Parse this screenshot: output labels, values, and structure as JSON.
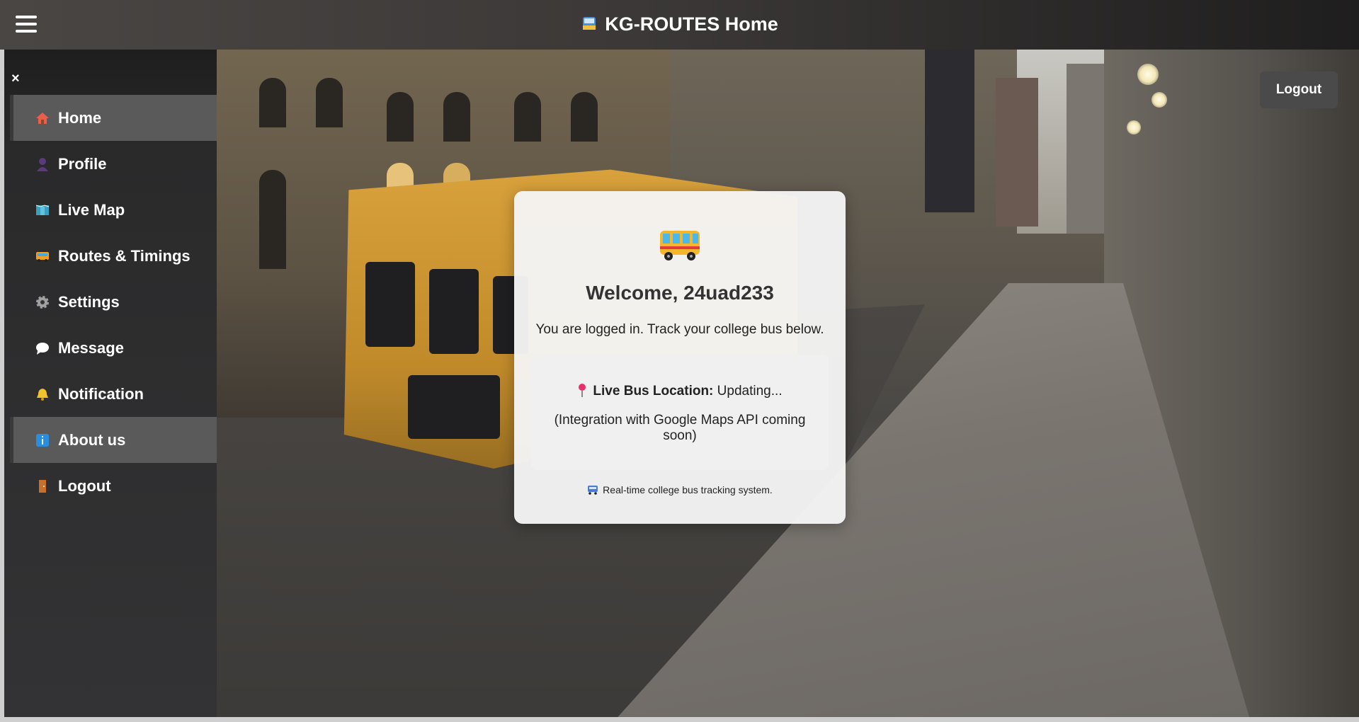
{
  "header": {
    "title": "KG-ROUTES Home",
    "menu_icon": "hamburger-menu-icon",
    "title_icon": "bus-icon"
  },
  "sidebar": {
    "close_label": "×",
    "items": [
      {
        "label": "Home",
        "icon": "house-icon",
        "active": true
      },
      {
        "label": "Profile",
        "icon": "person-icon",
        "active": false
      },
      {
        "label": "Live Map",
        "icon": "map-icon",
        "active": false
      },
      {
        "label": "Routes & Timings",
        "icon": "bus-icon",
        "active": false
      },
      {
        "label": "Settings",
        "icon": "gear-icon",
        "active": false
      },
      {
        "label": "Message",
        "icon": "speech-bubble-icon",
        "active": false
      },
      {
        "label": "Notification",
        "icon": "bell-icon",
        "active": false
      },
      {
        "label": "About us",
        "icon": "info-icon",
        "active": true
      },
      {
        "label": "Logout",
        "icon": "door-icon",
        "active": false
      }
    ]
  },
  "top_right": {
    "logout_label": "Logout"
  },
  "card": {
    "title": "Welcome, 24uad233",
    "subtitle": "You are logged in. Track your college bus below.",
    "location_label": "Live Bus Location:",
    "location_status": " Updating...",
    "integration_note": "(Integration with Google Maps API coming soon)",
    "footer": "Real-time college bus tracking system."
  },
  "colors": {
    "sidebar_bg": "#333335",
    "active_item_bg": "#5a5a5a",
    "topbar_bg": "#3a3736",
    "card_bg": "#f5f5f5",
    "logout_bg": "#4a4a4a"
  }
}
